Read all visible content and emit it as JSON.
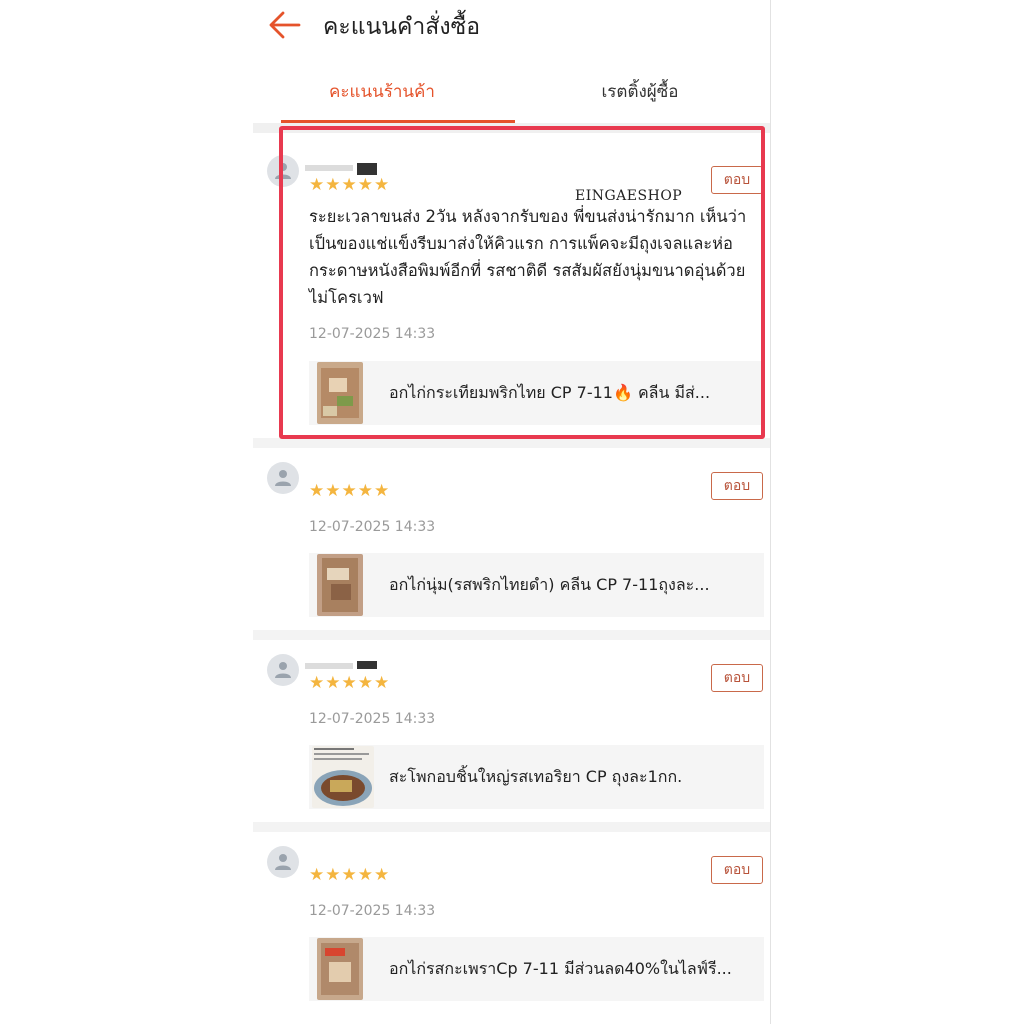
{
  "header": {
    "title": "คะแนนคำสั่งซื้อ",
    "back_icon": "arrow-left-icon"
  },
  "tabs": [
    {
      "label": "คะแนนร้านค้า",
      "active": true
    },
    {
      "label": "เรตติ้งผู้ซื้อ",
      "active": false
    }
  ],
  "colors": {
    "accent": "#e5532b",
    "star": "#f4b53f",
    "highlight": "#e8394f"
  },
  "watermark": "EINGAESHOP",
  "reviews": [
    {
      "stars": "★★★★★",
      "rating": 5,
      "reply_label": "ตอบ",
      "text": "ระยะเวลาขนส่ง 2วัน หลังจากรับของ พี่ขนส่งน่ารักมาก เห็นว่าเป็นของแช่แข็งรีบมาส่งให้คิวแรก การแพ็คจะมีถุงเจลและห่อกระดาษหนังสือพิมพ์อีกที่ รสชาติดี รสสัมผัสยังนุ่มขนาดอุ่นด้วยไม่โครเวฟ",
      "date": "12-07-2025 14:33",
      "product": "อกไก่กระเทียมพริกไทย CP  7-11🔥 คลีน มีส่..."
    },
    {
      "stars": "★★★★★",
      "rating": 5,
      "reply_label": "ตอบ",
      "date": "12-07-2025 14:33",
      "product": "อกไก่นุ่ม(รสพริกไทยดำ) คลีน CP 7-11ถุงละ..."
    },
    {
      "stars": "★★★★★",
      "rating": 5,
      "reply_label": "ตอบ",
      "date": "12-07-2025 14:33",
      "product": "สะโพกอบชิ้นใหญ่รสเทอริยา CP ถุงละ1กก."
    },
    {
      "stars": "★★★★★",
      "rating": 5,
      "reply_label": "ตอบ",
      "date": "12-07-2025 14:33",
      "product": "อกไก่รสกะเพราCp 7-11 มีส่วนลด40%ในไลฟ์รี..."
    }
  ]
}
